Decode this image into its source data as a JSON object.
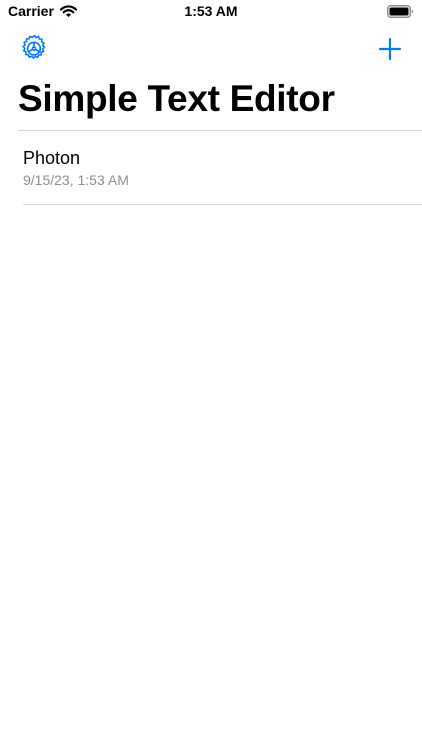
{
  "status_bar": {
    "carrier": "Carrier",
    "time": "1:53 AM",
    "wifi_icon": "wifi-icon",
    "battery_icon": "battery-full-icon"
  },
  "nav": {
    "settings_icon": "gear-icon",
    "add_icon": "plus-icon",
    "accent_color": "#007aff"
  },
  "title": "Simple Text Editor",
  "documents": [
    {
      "name": "Photon",
      "modified": "9/15/23, 1:53 AM"
    }
  ]
}
